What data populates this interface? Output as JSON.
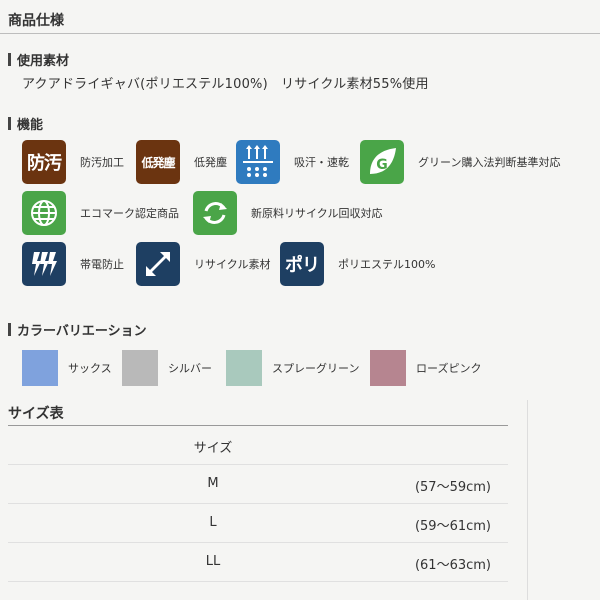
{
  "page": {
    "title": "商品仕様"
  },
  "material": {
    "heading": "使用素材",
    "text": "アクアドライギャバ(ポリエステル100%)　リサイクル素材55%使用"
  },
  "functions": {
    "heading": "機能",
    "items": [
      {
        "badge": "防汚",
        "label": "防汚加工",
        "color": "#6b3410"
      },
      {
        "badge": "低発塵",
        "label": "低発塵",
        "color": "#6b3410"
      },
      {
        "badge": "",
        "label": "吸汗・速乾",
        "color": "#2f7bbf",
        "icon": "sweat-drops-icon"
      },
      {
        "badge": "G",
        "label": "グリーン購入法判断基準対応",
        "color": "#4aa548",
        "icon": "green-leaf-icon"
      },
      {
        "badge": "",
        "label": "エコマーク認定商品",
        "color": "#4aa548",
        "icon": "globe-icon"
      },
      {
        "badge": "",
        "label": "新原料リサイクル回収対応",
        "color": "#4aa548",
        "icon": "recycle-icon"
      },
      {
        "badge": "",
        "label": "帯電防止",
        "color": "#1e3f62",
        "icon": "lightning-icon"
      },
      {
        "badge": "",
        "label": "リサイクル素材",
        "color": "#1e3f62",
        "icon": "arrows-icon"
      },
      {
        "badge": "ポリ",
        "label": "ポリエステル100%",
        "color": "#1e3f62"
      }
    ]
  },
  "colors": {
    "heading": "カラーバリエーション",
    "items": [
      {
        "name": "サックス",
        "swatch": "#7fa2dd"
      },
      {
        "name": "シルバー",
        "swatch": "#b9b9b9"
      },
      {
        "name": "スプレーグリーン",
        "swatch": "#a9c9bd"
      },
      {
        "name": "ローズピンク",
        "swatch": "#b68590"
      }
    ]
  },
  "sizes": {
    "heading": "サイズ表",
    "column_header": "サイズ",
    "rows": [
      {
        "size": "M",
        "range": "(57〜59cm)"
      },
      {
        "size": "L",
        "range": "(59〜61cm)"
      },
      {
        "size": "LL",
        "range": "(61〜63cm)"
      }
    ]
  }
}
